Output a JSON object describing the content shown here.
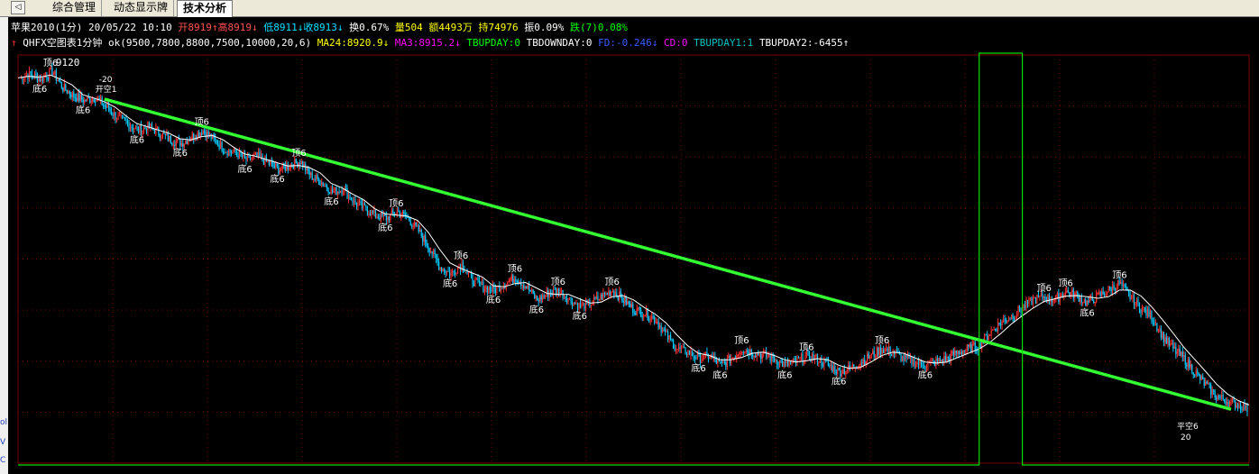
{
  "tabs": {
    "nav_glyph": "◁",
    "items": [
      {
        "label": "综合管理",
        "active": false
      },
      {
        "label": "动态显示牌",
        "active": false
      },
      {
        "label": "技术分析",
        "active": true
      }
    ]
  },
  "left_strip": [
    "ol",
    "V",
    "C"
  ],
  "quote": {
    "symbol": "苹果2010(1分)",
    "datetime": "20/05/22 10:10",
    "open": "开8919↑",
    "high": "高8919↓",
    "low": "低8911↓",
    "close": "收8913↓",
    "turnover": "换0.67%",
    "volume": "量504",
    "amount": "额4493万",
    "position": "持74976",
    "amplitude": "振0.09%",
    "change": "跌(7)0.08%"
  },
  "indicator": {
    "arrow": "↑",
    "name": "QHFX空图表1分钟",
    "params": "ok(9500,7800,8800,7500,10000,20,6)",
    "values": [
      {
        "label": "MA24:8920.9↓",
        "color": "#ffff00"
      },
      {
        "label": "MA3:8915.2↓",
        "color": "#ff00ff"
      },
      {
        "label": "TBUPDAY:0",
        "color": "#00ff00"
      },
      {
        "label": "TBDOWNDAY:0",
        "color": "#ffffff"
      },
      {
        "label": "FD:-0.246↓",
        "color": "#3a5cff"
      },
      {
        "label": "CD:0",
        "color": "#ff00ff"
      },
      {
        "label": "TBUPDAY1:1",
        "color": "#00c0c0"
      },
      {
        "label": "TBUPDAY2:-6455↑",
        "color": "#ffffff"
      }
    ]
  },
  "annotations": {
    "high_label": "9120",
    "open_short_value": "-20",
    "open_short_label": "开空1",
    "close_short_label": "平空6",
    "close_short_value": "20",
    "top_marker": "顶6",
    "bottom_marker": "底6"
  },
  "colors": {
    "background": "#000000",
    "grid": "#7a0000",
    "trend_line": "#33ff33",
    "ma_line": "#ffffff",
    "signal_line": "#00dd00",
    "candle_up": "#ff3030",
    "candle_down": "#00ccff"
  },
  "chart_data": {
    "type": "candlestick",
    "interval": "1分",
    "price_series": [
      9116,
      9118,
      9115,
      9120,
      9110,
      9105,
      9102,
      9104,
      9098,
      9092,
      9088,
      9084,
      9086,
      9082,
      9078,
      9076,
      9080,
      9084,
      9078,
      9072,
      9070,
      9066,
      9068,
      9064,
      9060,
      9062,
      9065,
      9056,
      9052,
      9046,
      9048,
      9040,
      9036,
      9032,
      9030,
      9034,
      9030,
      9022,
      9012,
      9000,
      8996,
      9002,
      8992,
      8988,
      8986,
      8990,
      8994,
      8988,
      8980,
      8984,
      8986,
      8980,
      8976,
      8978,
      8982,
      8986,
      8980,
      8974,
      8972,
      8968,
      8958,
      8950,
      8948,
      8944,
      8946,
      8940,
      8944,
      8950,
      8948,
      8946,
      8944,
      8940,
      8942,
      8946,
      8944,
      8940,
      8936,
      8938,
      8942,
      8946,
      8950,
      8948,
      8944,
      8942,
      8940,
      8942,
      8944,
      8948,
      8950,
      8952,
      8960,
      8966,
      8970,
      8975,
      8980,
      8982,
      8980,
      8985,
      8983,
      8978,
      8982,
      8986,
      8990,
      8982,
      8975,
      8970,
      8958,
      8950,
      8944,
      8936,
      8928,
      8921,
      8918,
      8916,
      8913
    ],
    "trend_line": {
      "start": 9103,
      "end": 8913
    },
    "signal_series": [
      0,
      0,
      0,
      0,
      0,
      0,
      0,
      0,
      0,
      0,
      0,
      0,
      0,
      0,
      0,
      0,
      0,
      0,
      0,
      0,
      0,
      0,
      0,
      0,
      0,
      0,
      0,
      0,
      0,
      0,
      0,
      0,
      0,
      0,
      0,
      0,
      0,
      0,
      0,
      0,
      0,
      0,
      0,
      0,
      0,
      0,
      0,
      0,
      0,
      0,
      0,
      0,
      0,
      0,
      0,
      0,
      0,
      0,
      0,
      0,
      0,
      0,
      0,
      0,
      0,
      0,
      0,
      0,
      0,
      0,
      0,
      0,
      0,
      0,
      0,
      0,
      0,
      0,
      0,
      0,
      0,
      0,
      0,
      0,
      0,
      0,
      0,
      0,
      0,
      1,
      1,
      1,
      1,
      0,
      0,
      0,
      0,
      0,
      0,
      0,
      0,
      0,
      0,
      0,
      0,
      0,
      0,
      0,
      0,
      0,
      0,
      0,
      0,
      0,
      0
    ],
    "ylim": [
      8880,
      9130
    ]
  }
}
